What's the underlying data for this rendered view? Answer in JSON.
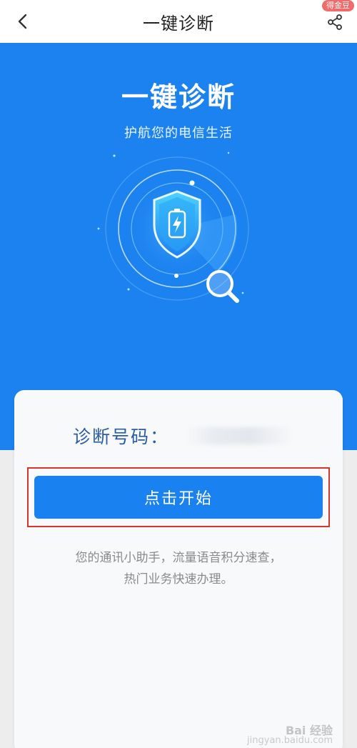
{
  "header": {
    "title": "一键诊断",
    "reward_badge": "得金豆",
    "back_icon": "chevron-left-icon",
    "share_icon": "share-icon"
  },
  "hero": {
    "title": "一键诊断",
    "subtitle": "护航您的电信生活",
    "graphic_icons": [
      "shield-battery-icon",
      "magnifier-icon"
    ],
    "colors": {
      "background": "#1b82f0"
    }
  },
  "card": {
    "number_label": "诊断号码：",
    "start_button": "点击开始",
    "description_line1": "您的通讯小助手，流量语音积分速查，",
    "description_line2": "热门业务快速办理。"
  },
  "watermark": {
    "main": "Bai 经验",
    "sub": "jingyan.baidu.com"
  }
}
